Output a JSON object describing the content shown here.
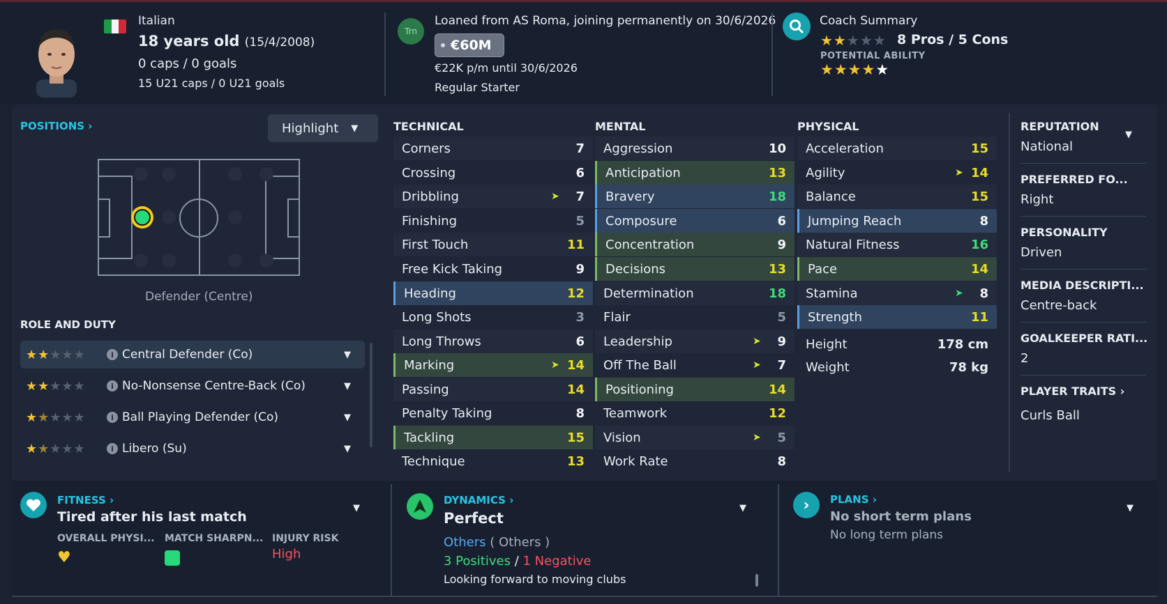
{
  "header": {
    "nationality": "Italian",
    "age": "18 years old",
    "dob": "(15/4/2008)",
    "caps": "0 caps / 0 goals",
    "u21": "15 U21 caps / 0 U21 goals",
    "transfer_badge": "Trn",
    "loan_text": "Loaned from AS Roma, joining permanently on 30/6/2026",
    "value": "€60M",
    "wage": "€22K p/m until 30/6/2026",
    "squad_status": "Regular Starter",
    "coach_title": "Coach Summary",
    "pros_cons": "8 Pros / 5 Cons",
    "potential_label": "POTENTIAL ABILITY",
    "current_stars": 2,
    "potential_stars": 4.5
  },
  "positions": {
    "link": "POSITIONS",
    "highlight": "Highlight",
    "position_label": "Defender (Centre)"
  },
  "roles": {
    "title": "ROLE AND DUTY",
    "items": [
      {
        "name": "Central Defender (Co)",
        "stars": 2
      },
      {
        "name": "No-Nonsense Centre-Back (Co)",
        "stars": 2
      },
      {
        "name": "Ball Playing Defender (Co)",
        "stars": 1.5
      },
      {
        "name": "Libero (Su)",
        "stars": 1.5
      }
    ]
  },
  "technical": {
    "title": "TECHNICAL",
    "attrs": [
      {
        "name": "Corners",
        "value": "7"
      },
      {
        "name": "Crossing",
        "value": "6"
      },
      {
        "name": "Dribbling",
        "value": "7"
      },
      {
        "name": "Finishing",
        "value": "5"
      },
      {
        "name": "First Touch",
        "value": "11"
      },
      {
        "name": "Free Kick Taking",
        "value": "9"
      },
      {
        "name": "Heading",
        "value": "12"
      },
      {
        "name": "Long Shots",
        "value": "3"
      },
      {
        "name": "Long Throws",
        "value": "6"
      },
      {
        "name": "Marking",
        "value": "14"
      },
      {
        "name": "Passing",
        "value": "14"
      },
      {
        "name": "Penalty Taking",
        "value": "8"
      },
      {
        "name": "Tackling",
        "value": "15"
      },
      {
        "name": "Technique",
        "value": "13"
      }
    ]
  },
  "mental": {
    "title": "MENTAL",
    "attrs": [
      {
        "name": "Aggression",
        "value": "10"
      },
      {
        "name": "Anticipation",
        "value": "13"
      },
      {
        "name": "Bravery",
        "value": "18"
      },
      {
        "name": "Composure",
        "value": "6"
      },
      {
        "name": "Concentration",
        "value": "9"
      },
      {
        "name": "Decisions",
        "value": "13"
      },
      {
        "name": "Determination",
        "value": "18"
      },
      {
        "name": "Flair",
        "value": "5"
      },
      {
        "name": "Leadership",
        "value": "9"
      },
      {
        "name": "Off The Ball",
        "value": "7"
      },
      {
        "name": "Positioning",
        "value": "14"
      },
      {
        "name": "Teamwork",
        "value": "12"
      },
      {
        "name": "Vision",
        "value": "5"
      },
      {
        "name": "Work Rate",
        "value": "8"
      }
    ]
  },
  "physical": {
    "title": "PHYSICAL",
    "attrs": [
      {
        "name": "Acceleration",
        "value": "15"
      },
      {
        "name": "Agility",
        "value": "14"
      },
      {
        "name": "Balance",
        "value": "15"
      },
      {
        "name": "Jumping Reach",
        "value": "8"
      },
      {
        "name": "Natural Fitness",
        "value": "16"
      },
      {
        "name": "Pace",
        "value": "14"
      },
      {
        "name": "Stamina",
        "value": "8"
      },
      {
        "name": "Strength",
        "value": "11"
      }
    ],
    "height_label": "Height",
    "height": "178 cm",
    "weight_label": "Weight",
    "weight": "78 kg"
  },
  "side": {
    "reputation_label": "REPUTATION",
    "reputation": "National",
    "foot_label": "PREFERRED FO...",
    "foot": "Right",
    "personality_label": "PERSONALITY",
    "personality": "Driven",
    "media_label": "MEDIA DESCRIPTI...",
    "media": "Centre-back",
    "gk_label": "GOALKEEPER RATI...",
    "gk": "2",
    "traits_label": "PLAYER TRAITS",
    "traits": "Curls Ball"
  },
  "fitness": {
    "link": "FITNESS",
    "status": "Tired after his last match",
    "overall_label": "OVERALL PHYSI...",
    "sharpness_label": "MATCH SHARPN...",
    "injury_label": "INJURY RISK",
    "injury_value": "High"
  },
  "dynamics": {
    "link": "DYNAMICS",
    "status": "Perfect",
    "group": "Others",
    "group_paren": "( Others )",
    "positives": "3 Positives",
    "slash": "/",
    "negatives": "1 Negative",
    "note": "Looking forward to moving clubs"
  },
  "plans": {
    "link": "PLANS",
    "short": "No short term plans",
    "long": "No long term plans"
  },
  "colors": {
    "accent": "#2ac4e4",
    "background": "#1b2131",
    "panel": "#1f2637",
    "gold": "#f3c431",
    "highlight_blue": "#30445f",
    "highlight_green": "#33473f",
    "injury_high": "#ff4f5e",
    "positive": "#3fdc7a",
    "negative": "#ff4f5e"
  },
  "icons": [
    "italy-flag-icon",
    "transfer-badge-icon",
    "search-icon",
    "chevron-down-icon",
    "info-icon",
    "heart-icon",
    "arrow-up-icon",
    "chevron-right-icon"
  ]
}
